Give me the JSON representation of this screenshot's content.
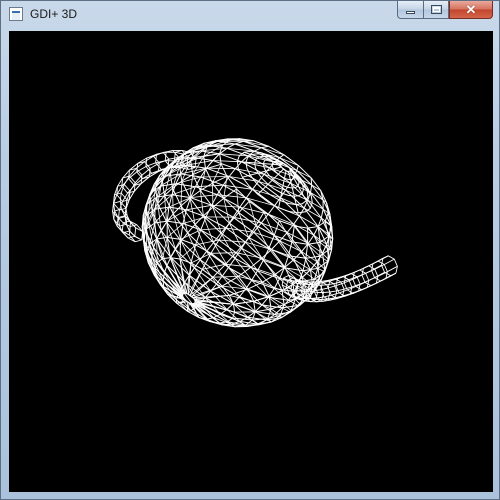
{
  "window": {
    "title": "GDI+ 3D",
    "app_icon": "window-app-icon"
  },
  "controls": {
    "minimize_icon": "minimize-icon",
    "maximize_icon": "maximize-icon",
    "close_icon": "close-icon",
    "close_glyph": "✕",
    "close_color": "#c9452c"
  },
  "canvas": {
    "background": "#000000",
    "wire_color": "#ffffff",
    "model": "teapot-wireframe"
  }
}
